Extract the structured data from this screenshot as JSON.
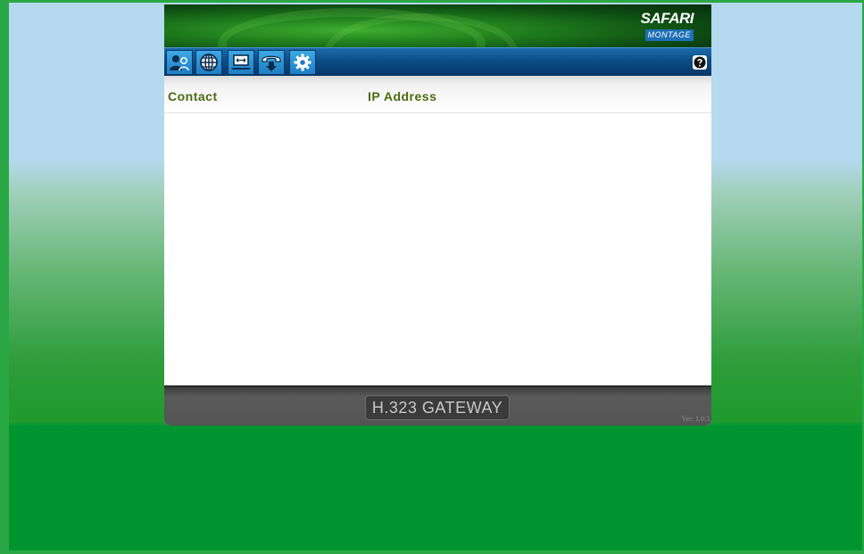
{
  "app": {
    "logo_top": "SAFARI",
    "logo_bottom": "MONTAGE"
  },
  "toolbar": {
    "buttons": [
      {
        "icon": "contacts-icon"
      },
      {
        "icon": "globe-icon"
      },
      {
        "icon": "laptop-transfer-icon"
      },
      {
        "icon": "phone-download-icon"
      },
      {
        "icon": "gear-icon"
      }
    ],
    "help_icon": "help-icon"
  },
  "table": {
    "columns": [
      "Contact",
      "IP Address"
    ],
    "rows": []
  },
  "footer": {
    "product_label": "H.323 GATEWAY",
    "version": "Ver: 1.0.3"
  },
  "colors": {
    "toolbar": "#0d4d85",
    "header_green": "#1f7d1d",
    "column_text": "#4c6b12",
    "footer": "#545454",
    "frame_green": "#2aa845"
  }
}
